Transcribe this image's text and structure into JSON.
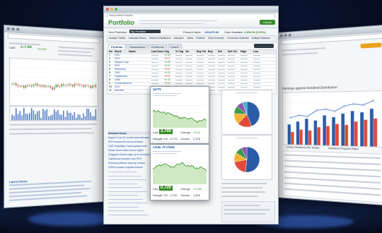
{
  "app": {
    "title": "Portfolio",
    "create_button": "Create",
    "address": "www.portfolio.example"
  },
  "portfolio": {
    "selector_label": "Your Portfolios",
    "selector_value": "My Portfolio",
    "value_label": "Present Value",
    "value": "135,879.06",
    "cash_label": "Cash Available",
    "cash_value": "2,856.08 (5.50%)",
    "tabs": [
      "Portfolio",
      "Transactions",
      "Dividends",
      "Charts"
    ],
    "toolbar": [
      "Analyse Trades",
      "Calculate Return",
      "Dividend Distribution",
      "Allocation",
      "Alerts",
      "Portfolio",
      "Stock Screener",
      "Consensus Estimate",
      "Multiple Selection"
    ],
    "table_headers": [
      "No.",
      "Stock",
      "Name",
      "Last Done",
      "Chg",
      "% Chg",
      "Vol",
      "Buy Vol",
      "Buy",
      "Sell",
      "Sell Vol",
      "High",
      "Low"
    ],
    "rows": [
      {
        "no": "1",
        "stock": "D05",
        "chg": "+0.02"
      },
      {
        "no": "2",
        "stock": "G13",
        "chg": "-0.01"
      },
      {
        "no": "3",
        "stock": "Keppel Corp",
        "chg": "+0.05"
      },
      {
        "no": "4",
        "stock": "SPH",
        "chg": "+0.01"
      },
      {
        "no": "5",
        "stock": "Sembcorp",
        "chg": "-0.02"
      },
      {
        "no": "6",
        "stock": "OUE",
        "chg": "+0.01"
      },
      {
        "no": "7",
        "stock": "CapitaLand",
        "chg": "-0.03"
      },
      {
        "no": "8",
        "stock": "UOB",
        "chg": "+0.10"
      },
      {
        "no": "9",
        "stock": "ComfortDelGro",
        "chg": "+0.01"
      },
      {
        "no": "10",
        "stock": "SGX",
        "chg": "-0.04"
      },
      {
        "no": "11",
        "stock": "StarHub",
        "chg": "+0.02"
      }
    ]
  },
  "popup_spl": {
    "ticker": "SPH",
    "last_label": "Last",
    "last": "3.760",
    "change_label": "Change",
    "change": "+0.01",
    "range_label": "Range",
    "range": "3.740 - 3.770",
    "volume_label": "Volume",
    "volume": "2,376"
  },
  "popup_oue": {
    "ticker": "OUE HTrust",
    "last_label": "Last",
    "last": "0.720",
    "change_label": "Change",
    "change": "+0.005",
    "range_label": "Range",
    "range": "0.710 - 0.720",
    "volume_label": "Volume",
    "volume": "1,820"
  },
  "news": {
    "title": "Related News",
    "items": [
      "Keppel Corp Q2 results beat estimates",
      "SPH announces interim dividend",
      "OUE Hospitality Trust acquires hotel",
      "Straits Times Index closes higher",
      "Singapore shares edge up in morning trade",
      "CapitaLand launches new REIT",
      "Sembcorp Marine wins rig contract",
      "UOB to expand regional network"
    ]
  },
  "right_screen": {
    "title": "Earnings against Dividend Distribution",
    "legend": [
      "Gross Dividend Per Share",
      "Dividend Payout Ratio"
    ],
    "bars_a": [
      0.48,
      0.55,
      0.62,
      0.58,
      0.7,
      0.66,
      0.74,
      0.8,
      0.77,
      0.85
    ],
    "bars_b": [
      0.3,
      0.36,
      0.34,
      0.42,
      0.45,
      0.5,
      0.48,
      0.56,
      0.6,
      0.63
    ],
    "line": [
      0.55,
      0.6,
      0.58,
      0.7,
      0.72,
      0.68,
      0.78,
      0.82,
      0.8,
      0.88
    ]
  },
  "left_screen": {
    "price_label": "Last",
    "price": "1.730",
    "price_change": "+0.010",
    "news_title": "Latest News"
  },
  "colors": {
    "brand_green": "#3a8c2b",
    "up": "#2f8c1e",
    "down": "#c0392b",
    "link": "#2057a8",
    "pie": [
      "#2b5ca8",
      "#e04b3a",
      "#f2b233",
      "#3c9a4c",
      "#8e56b0",
      "#46b3c9"
    ]
  },
  "icons": [
    "refresh-icon",
    "search-icon",
    "star-icon"
  ]
}
